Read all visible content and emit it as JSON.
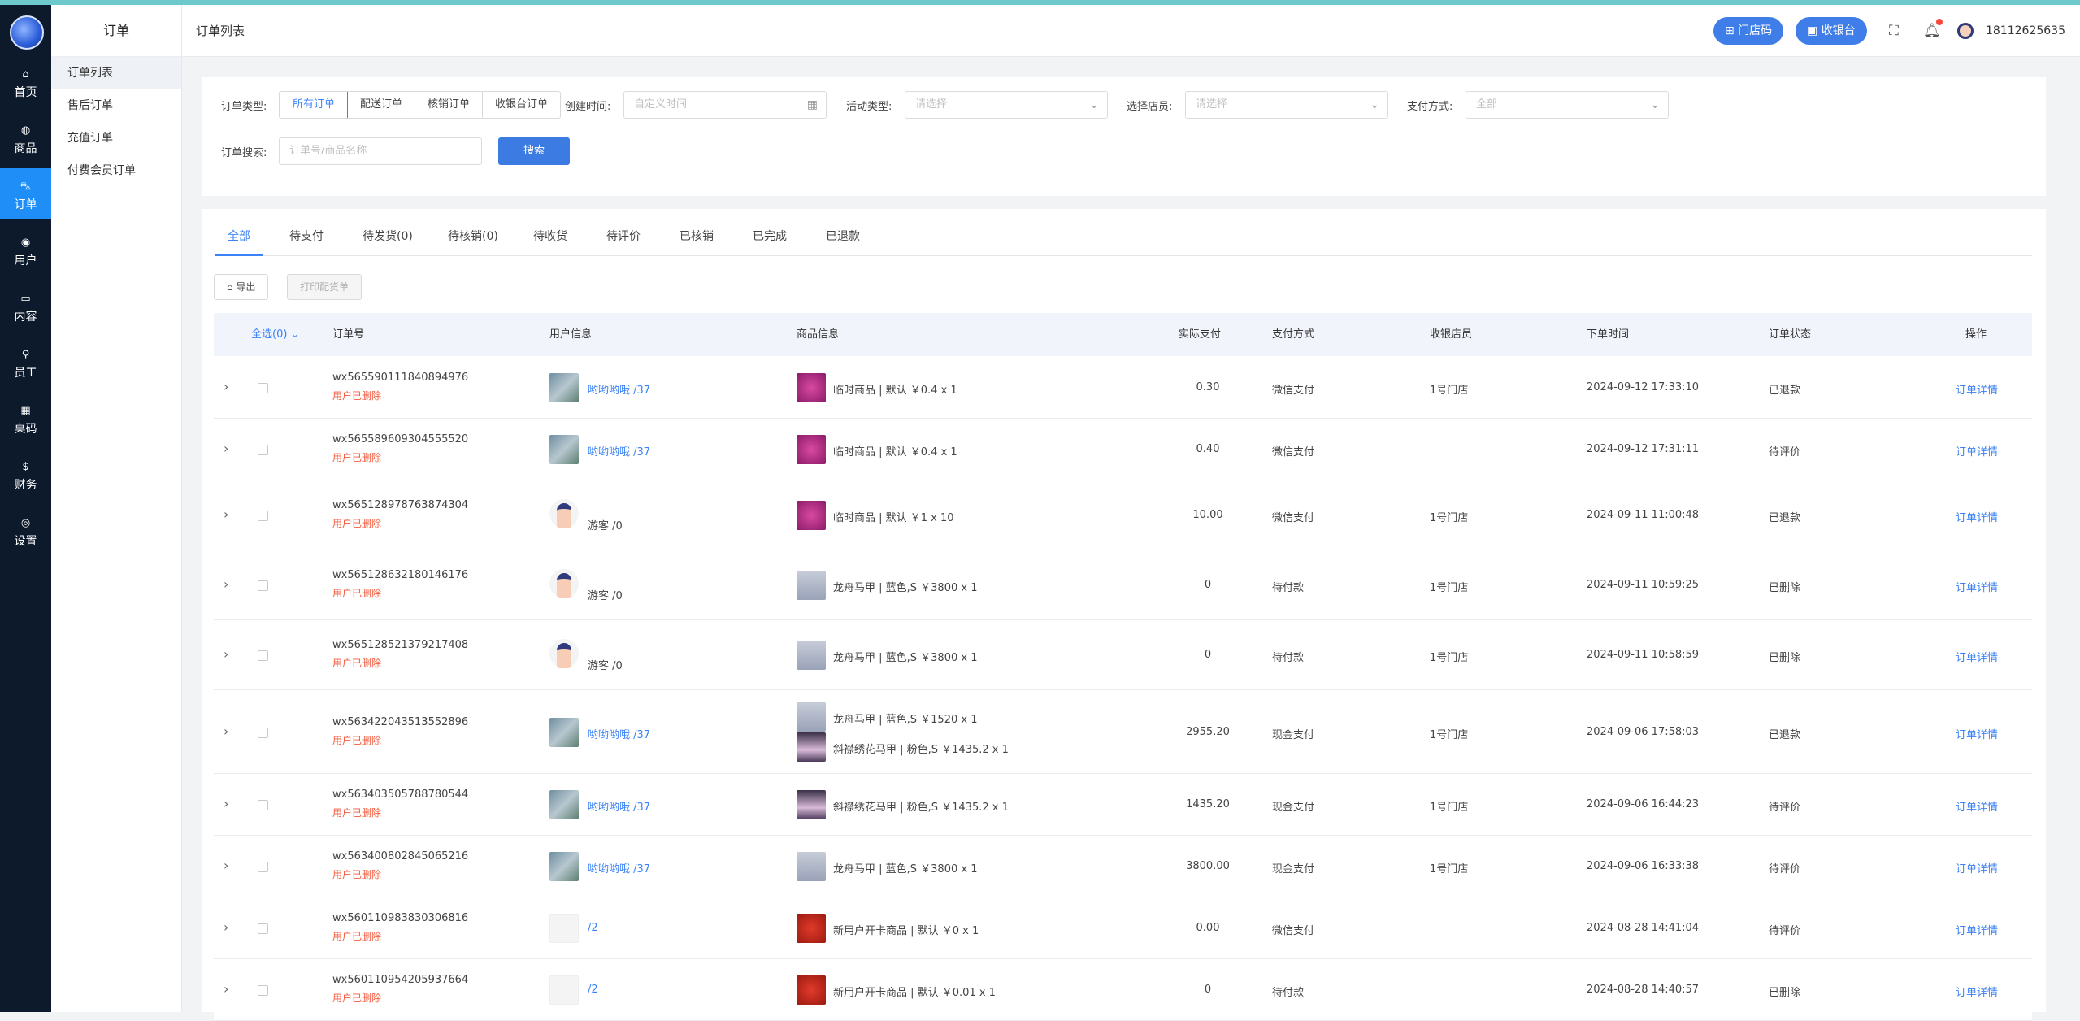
{
  "sidebar": {
    "items": [
      {
        "icon": "home-icon",
        "glyph": "⌂",
        "label": "首页"
      },
      {
        "icon": "shop-icon",
        "glyph": "◍",
        "label": "商品"
      },
      {
        "icon": "cart-icon",
        "glyph": "⛍",
        "label": "订单",
        "active": true
      },
      {
        "icon": "users-icon",
        "glyph": "◉",
        "label": "用户"
      },
      {
        "icon": "content-icon",
        "glyph": "▭",
        "label": "内容"
      },
      {
        "icon": "staff-icon",
        "glyph": "⚲",
        "label": "员工"
      },
      {
        "icon": "table-code-icon",
        "glyph": "▦",
        "label": "桌码"
      },
      {
        "icon": "dollar-icon",
        "glyph": "$",
        "label": "财务"
      },
      {
        "icon": "settings-icon",
        "glyph": "◎",
        "label": "设置"
      }
    ]
  },
  "submenu": {
    "title": "订单",
    "items": [
      "订单列表",
      "售后订单",
      "充值订单",
      "付费会员订单"
    ]
  },
  "header": {
    "title": "订单列表",
    "store_code": "门店码",
    "cashier": "收银台",
    "phone": "18112625635"
  },
  "filters": {
    "order_type_label": "订单类型:",
    "order_types": [
      "所有订单",
      "配送订单",
      "核销订单",
      "收银台订单"
    ],
    "created_label": "创建时间:",
    "created_placeholder": "自定义时间",
    "activity_label": "活动类型:",
    "activity_placeholder": "请选择",
    "clerk_label": "选择店员:",
    "clerk_placeholder": "请选择",
    "pay_label": "支付方式:",
    "pay_placeholder": "全部",
    "search_label": "订单搜索:",
    "search_placeholder": "订单号/商品名称",
    "search_button": "搜索"
  },
  "tabs": [
    "全部",
    "待支付",
    "待发货(0)",
    "待核销(0)",
    "待收货",
    "待评价",
    "已核销",
    "已完成",
    "已退款"
  ],
  "actions": {
    "export": "导出",
    "print": "打印配货单"
  },
  "table": {
    "headers": {
      "select": "全选(0)",
      "order_no": "订单号",
      "user": "用户信息",
      "goods": "商品信息",
      "paid": "实际支付",
      "pay_method": "支付方式",
      "clerk": "收银店员",
      "time": "下单时间",
      "status": "订单状态",
      "op": "操作"
    },
    "deleted_text": "用户已删除",
    "detail_text": "订单详情",
    "rows": [
      {
        "order_no": "wx565590111840894976",
        "avatar": "city",
        "user": "哟哟哟哦",
        "uid": "/37",
        "goods": [
          {
            "thumb": "pink",
            "name": "临时商品 | 默认 ￥0.4 x 1"
          }
        ],
        "paid": "0.30",
        "method": "微信支付",
        "clerk": "1号门店",
        "time": "2024-09-12 17:33:10",
        "status": "已退款"
      },
      {
        "order_no": "wx565589609304555520",
        "avatar": "city",
        "user": "哟哟哟哦",
        "uid": "/37",
        "goods": [
          {
            "thumb": "pink",
            "name": "临时商品 | 默认 ￥0.4 x 1"
          }
        ],
        "paid": "0.40",
        "method": "微信支付",
        "clerk": "",
        "time": "2024-09-12 17:31:11",
        "status": "待评价"
      },
      {
        "order_no": "wx565128978763874304",
        "avatar": "guest",
        "user": "游客",
        "uid": "/0",
        "goods": [
          {
            "thumb": "pink",
            "name": "临时商品 | 默认 ￥1 x 10"
          }
        ],
        "paid": "10.00",
        "method": "微信支付",
        "clerk": "1号门店",
        "time": "2024-09-11 11:00:48",
        "status": "已退款"
      },
      {
        "order_no": "wx565128632180146176",
        "avatar": "guest",
        "user": "游客",
        "uid": "/0",
        "goods": [
          {
            "thumb": "dress",
            "name": "龙舟马甲 | 蓝色,S ￥3800 x 1"
          }
        ],
        "paid": "0",
        "method": "待付款",
        "clerk": "1号门店",
        "time": "2024-09-11 10:59:25",
        "status": "已删除"
      },
      {
        "order_no": "wx565128521379217408",
        "avatar": "guest",
        "user": "游客",
        "uid": "/0",
        "goods": [
          {
            "thumb": "dress",
            "name": "龙舟马甲 | 蓝色,S ￥3800 x 1"
          }
        ],
        "paid": "0",
        "method": "待付款",
        "clerk": "1号门店",
        "time": "2024-09-11 10:58:59",
        "status": "已删除"
      },
      {
        "order_no": "wx563422043513552896",
        "avatar": "city",
        "user": "哟哟哟哦",
        "uid": "/37",
        "goods": [
          {
            "thumb": "dress",
            "name": "龙舟马甲 | 蓝色,S ￥1520 x 1"
          },
          {
            "thumb": "dark",
            "name": "斜襟绣花马甲 | 粉色,S ￥1435.2 x 1"
          }
        ],
        "paid": "2955.20",
        "method": "现金支付",
        "clerk": "1号门店",
        "time": "2024-09-06 17:58:03",
        "status": "已退款"
      },
      {
        "order_no": "wx563403505788780544",
        "avatar": "city",
        "user": "哟哟哟哦",
        "uid": "/37",
        "goods": [
          {
            "thumb": "dark",
            "name": "斜襟绣花马甲 | 粉色,S ￥1435.2 x 1"
          }
        ],
        "paid": "1435.20",
        "method": "现金支付",
        "clerk": "1号门店",
        "time": "2024-09-06 16:44:23",
        "status": "待评价"
      },
      {
        "order_no": "wx563400802845065216",
        "avatar": "city",
        "user": "哟哟哟哦",
        "uid": "/37",
        "goods": [
          {
            "thumb": "dress",
            "name": "龙舟马甲 | 蓝色,S ￥3800 x 1"
          }
        ],
        "paid": "3800.00",
        "method": "现金支付",
        "clerk": "1号门店",
        "time": "2024-09-06 16:33:38",
        "status": "待评价"
      },
      {
        "order_no": "wx560110983830306816",
        "avatar": "blank",
        "user": "",
        "uid": "/2",
        "goods": [
          {
            "thumb": "red",
            "name": "新用户开卡商品 | 默认 ￥0 x 1"
          }
        ],
        "paid": "0.00",
        "method": "微信支付",
        "clerk": "",
        "time": "2024-08-28 14:41:04",
        "status": "待评价"
      },
      {
        "order_no": "wx560110954205937664",
        "avatar": "blank",
        "user": "",
        "uid": "/2",
        "goods": [
          {
            "thumb": "red",
            "name": "新用户开卡商品 | 默认 ￥0.01 x 1"
          }
        ],
        "paid": "0",
        "method": "待付款",
        "clerk": "",
        "time": "2024-08-28 14:40:57",
        "status": "已删除"
      }
    ]
  }
}
